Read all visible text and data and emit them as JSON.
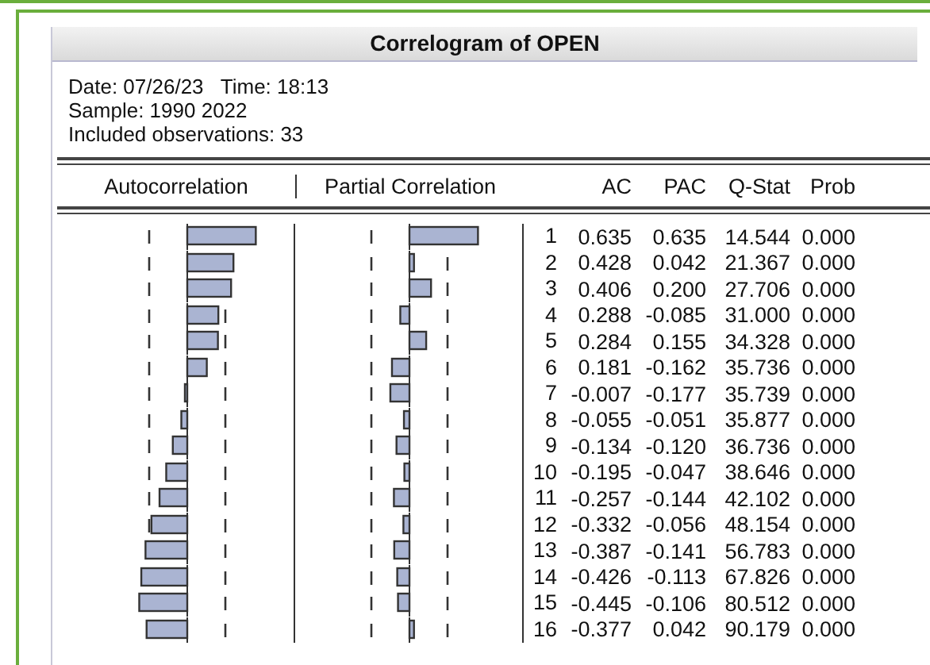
{
  "window": {
    "title": "Correlogram of OPEN"
  },
  "info": [
    "Date: 07/26/23   Time: 18:13",
    "Sample: 1990 2022",
    "Included observations: 33"
  ],
  "columns": [
    "Autocorrelation",
    "Partial Correlation",
    "AC",
    "PAC",
    "Q-Stat",
    "Prob"
  ],
  "rows": [
    {
      "lag": "1",
      "ac": "0.635",
      "pac": "0.635",
      "q": "14.544",
      "prob": "0.000"
    },
    {
      "lag": "2",
      "ac": "0.428",
      "pac": "0.042",
      "q": "21.367",
      "prob": "0.000"
    },
    {
      "lag": "3",
      "ac": "0.406",
      "pac": "0.200",
      "q": "27.706",
      "prob": "0.000"
    },
    {
      "lag": "4",
      "ac": "0.288",
      "pac": "-0.085",
      "q": "31.000",
      "prob": "0.000"
    },
    {
      "lag": "5",
      "ac": "0.284",
      "pac": "0.155",
      "q": "34.328",
      "prob": "0.000"
    },
    {
      "lag": "6",
      "ac": "0.181",
      "pac": "-0.162",
      "q": "35.736",
      "prob": "0.000"
    },
    {
      "lag": "7",
      "ac": "-0.007",
      "pac": "-0.177",
      "q": "35.739",
      "prob": "0.000"
    },
    {
      "lag": "8",
      "ac": "-0.055",
      "pac": "-0.051",
      "q": "35.877",
      "prob": "0.000"
    },
    {
      "lag": "9",
      "ac": "-0.134",
      "pac": "-0.120",
      "q": "36.736",
      "prob": "0.000"
    },
    {
      "lag": "10",
      "ac": "-0.195",
      "pac": "-0.047",
      "q": "38.646",
      "prob": "0.000"
    },
    {
      "lag": "11",
      "ac": "-0.257",
      "pac": "-0.144",
      "q": "42.102",
      "prob": "0.000"
    },
    {
      "lag": "12",
      "ac": "-0.332",
      "pac": "-0.056",
      "q": "48.154",
      "prob": "0.000"
    },
    {
      "lag": "13",
      "ac": "-0.387",
      "pac": "-0.141",
      "q": "56.783",
      "prob": "0.000"
    },
    {
      "lag": "14",
      "ac": "-0.426",
      "pac": "-0.113",
      "q": "67.826",
      "prob": "0.000"
    },
    {
      "lag": "15",
      "ac": "-0.445",
      "pac": "-0.106",
      "q": "80.512",
      "prob": "0.000"
    },
    {
      "lag": "16",
      "ac": "-0.377",
      "pac": "0.042",
      "q": "90.179",
      "prob": "0.000"
    }
  ]
}
